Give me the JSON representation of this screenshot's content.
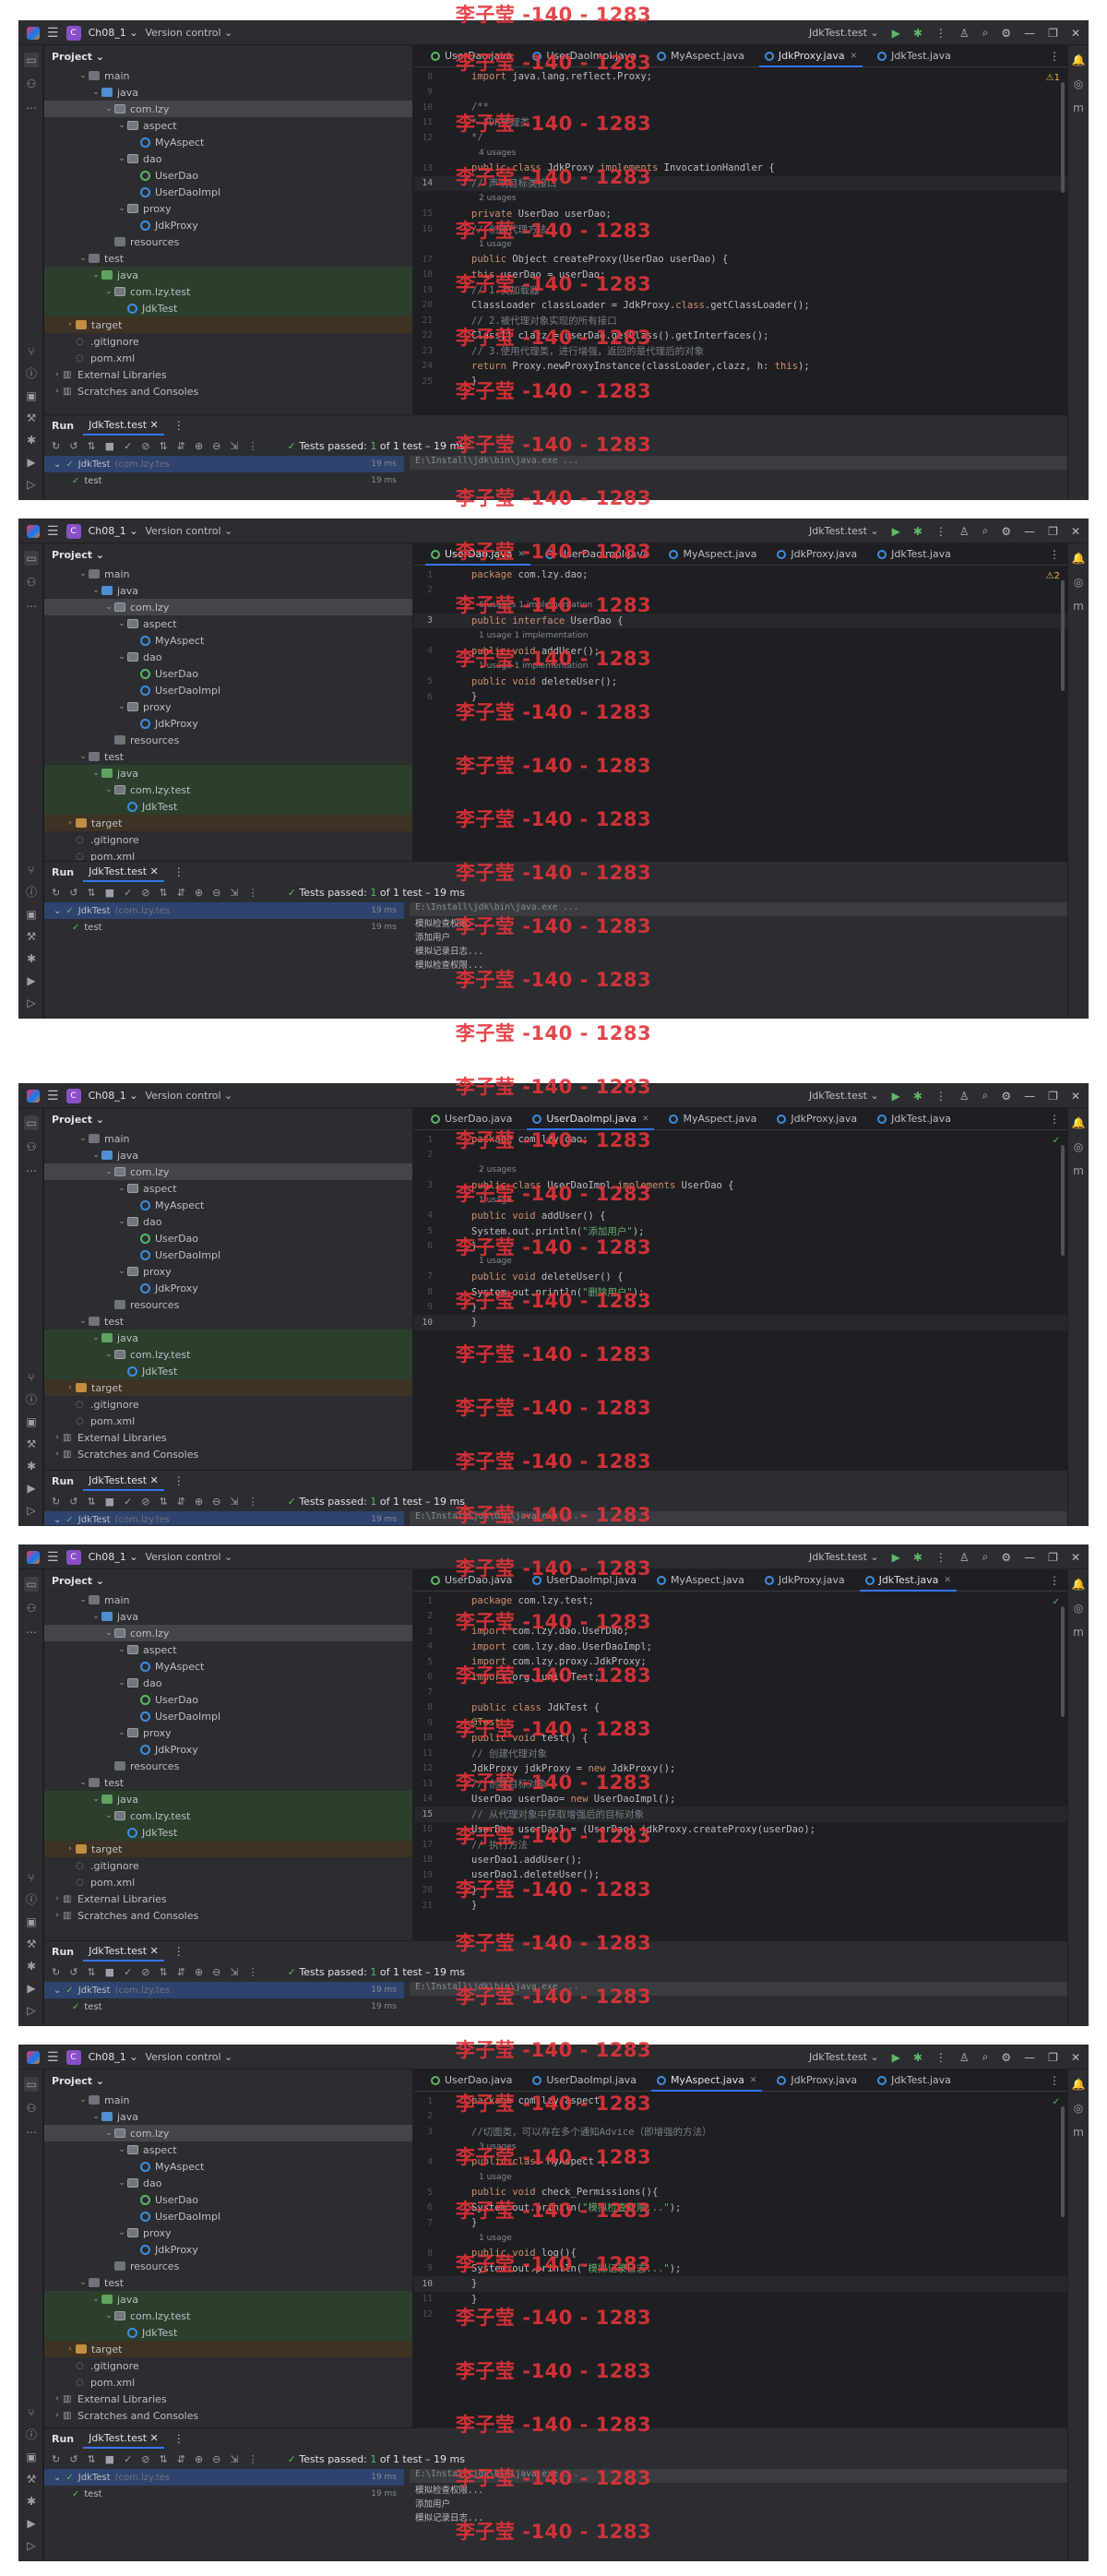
{
  "watermark": "李子莹 -140 - 1283",
  "ide": {
    "project_badge": "C",
    "project_name": "Ch08_1",
    "vcs": "Version control",
    "run_config": "JdkTest.test",
    "panel_title": "Project",
    "tree": [
      "main",
      "java",
      "com.lzy",
      "aspect",
      "MyAspect",
      "dao",
      "UserDao",
      "UserDaoImpl",
      "proxy",
      "JdkProxy",
      "resources",
      "test",
      "java",
      "com.lzy.test",
      "JdkTest",
      "target",
      ".gitignore",
      "pom.xml",
      "External Libraries",
      "Scratches and Consoles"
    ],
    "run_title": "Run",
    "run_tab": "JdkTest.test",
    "tests_passed_prefix": "Tests passed:",
    "tests_passed_count": "1",
    "tests_passed_suffix": "of 1 test – 19 ms",
    "run_tree": {
      "root": "JdkTest",
      "root_pkg": "(com.lzy.tes",
      "root_time": "19 ms",
      "child": "test",
      "child_time": "19 ms"
    },
    "console_path": "E:\\Install\\jdk\\bin\\java.exe ..."
  },
  "tabs": [
    "UserDao.java",
    "UserDaoImpl.java",
    "MyAspect.java",
    "JdkProxy.java",
    "JdkTest.java"
  ],
  "shots": [
    {
      "active_tab": 3,
      "indicator": "⚠1",
      "lines": [
        {
          "n": "8",
          "t": "import java.lang.reflect.Proxy;"
        },
        {
          "n": "9",
          "t": ""
        },
        {
          "n": "10",
          "t": "/**"
        },
        {
          "n": "11",
          "t": " * JDK代理类"
        },
        {
          "n": "12",
          "t": " */"
        },
        {
          "n": "",
          "t": "4 usages"
        },
        {
          "n": "13",
          "t": "public class JdkProxy implements InvocationHandler {"
        },
        {
          "n": "14",
          "t": "    // 声明目标类接口"
        },
        {
          "n": "",
          "t": "2 usages"
        },
        {
          "n": "15",
          "t": "    private UserDao userDao;"
        },
        {
          "n": "16",
          "t": "    // 创建代理方法"
        },
        {
          "n": "",
          "t": "1 usage"
        },
        {
          "n": "17",
          "t": "    public Object createProxy(UserDao userDao) {"
        },
        {
          "n": "18",
          "t": "        this.userDao = userDao;"
        },
        {
          "n": "19",
          "t": "        // 1.类加载器"
        },
        {
          "n": "20",
          "t": "        ClassLoader classLoader = JdkProxy.class.getClassLoader();"
        },
        {
          "n": "21",
          "t": "        // 2.被代理对象实现的所有接口"
        },
        {
          "n": "22",
          "t": "        Class[] clazz = userDao.getClass().getInterfaces();"
        },
        {
          "n": "23",
          "t": "        // 3.使用代理类，进行增强，返回的是代理后的对象"
        },
        {
          "n": "24",
          "t": "        return Proxy.newProxyInstance(classLoader,clazz, h: this);"
        },
        {
          "n": "25",
          "t": "    }"
        }
      ],
      "console": []
    },
    {
      "active_tab": 0,
      "indicator": "⚠2",
      "lines": [
        {
          "n": "1",
          "t": "package com.lzy.dao;"
        },
        {
          "n": "2",
          "t": ""
        },
        {
          "n": "",
          "t": "6 usages   1 implementation"
        },
        {
          "n": "3",
          "t": "public interface UserDao {"
        },
        {
          "n": "",
          "t": "1 usage   1 implementation"
        },
        {
          "n": "4",
          "t": "    public void addUser();"
        },
        {
          "n": "",
          "t": "1 usage   1 implementation"
        },
        {
          "n": "5",
          "t": "    public void deleteUser();"
        },
        {
          "n": "6",
          "t": "}"
        }
      ],
      "console": [
        "模拟检查权限...",
        "添加用户",
        "模拟记录日志...",
        "模拟检查权限..."
      ]
    },
    {
      "active_tab": 1,
      "indicator": "✓",
      "lines": [
        {
          "n": "1",
          "t": "package com.lzy.dao;"
        },
        {
          "n": "2",
          "t": ""
        },
        {
          "n": "",
          "t": "2 usages"
        },
        {
          "n": "3",
          "t": "public class UserDaoImpl implements UserDao {"
        },
        {
          "n": "",
          "t": "1 usage"
        },
        {
          "n": "4",
          "t": "    public void addUser() {"
        },
        {
          "n": "5",
          "t": "        System.out.println(\"添加用户\");"
        },
        {
          "n": "6",
          "t": "    }"
        },
        {
          "n": "",
          "t": "1 usage"
        },
        {
          "n": "7",
          "t": "    public void deleteUser() {"
        },
        {
          "n": "8",
          "t": "        System.out.println(\"删除用户\");"
        },
        {
          "n": "9",
          "t": "    }"
        },
        {
          "n": "10",
          "t": "}"
        }
      ],
      "console": []
    },
    {
      "active_tab": 4,
      "indicator": "✓",
      "lines": [
        {
          "n": "1",
          "t": "package com.lzy.test;"
        },
        {
          "n": "2",
          "t": ""
        },
        {
          "n": "3",
          "t": "import com.lzy.dao.UserDao;"
        },
        {
          "n": "4",
          "t": "import com.lzy.dao.UserDaoImpl;"
        },
        {
          "n": "5",
          "t": "import com.lzy.proxy.JdkProxy;"
        },
        {
          "n": "6",
          "t": "import org.junit.Test;"
        },
        {
          "n": "7",
          "t": ""
        },
        {
          "n": "8",
          "t": "public class JdkTest {"
        },
        {
          "n": "9",
          "t": "    @Test"
        },
        {
          "n": "10",
          "t": "    public void test() {"
        },
        {
          "n": "11",
          "t": "        // 创建代理对象"
        },
        {
          "n": "12",
          "t": "        JdkProxy jdkProxy = new JdkProxy();"
        },
        {
          "n": "13",
          "t": "        // 创建目标对象"
        },
        {
          "n": "14",
          "t": "        UserDao userDao= new UserDaoImpl();"
        },
        {
          "n": "15",
          "t": "        // 从代理对象中获取增强后的目标对象"
        },
        {
          "n": "16",
          "t": "        UserDao userDao1 = (UserDao) jdkProxy.createProxy(userDao);"
        },
        {
          "n": "17",
          "t": "        // 执行方法"
        },
        {
          "n": "18",
          "t": "        userDao1.addUser();"
        },
        {
          "n": "19",
          "t": "        userDao1.deleteUser();"
        },
        {
          "n": "20",
          "t": "    }"
        },
        {
          "n": "21",
          "t": "}"
        }
      ],
      "console": []
    },
    {
      "active_tab": 2,
      "indicator": "✓",
      "lines": [
        {
          "n": "1",
          "t": "package com.lzy.aspect;"
        },
        {
          "n": "2",
          "t": ""
        },
        {
          "n": "3",
          "t": "//切面类，可以存在多个通知Advice（即增强的方法）"
        },
        {
          "n": "",
          "t": "3 usages"
        },
        {
          "n": "4",
          "t": "public class MyAspect {"
        },
        {
          "n": "",
          "t": "1 usage"
        },
        {
          "n": "5",
          "t": "    public void check_Permissions(){"
        },
        {
          "n": "6",
          "t": "        System.out.println(\"模拟检查权限...\");"
        },
        {
          "n": "7",
          "t": "    }"
        },
        {
          "n": "",
          "t": "1 usage"
        },
        {
          "n": "8",
          "t": "    public void log(){"
        },
        {
          "n": "9",
          "t": "        System.out.println(\"模拟记录日志...\");"
        },
        {
          "n": "10",
          "t": "    }"
        },
        {
          "n": "11",
          "t": "}"
        },
        {
          "n": "12",
          "t": ""
        }
      ],
      "console": [
        "模拟检查权限...",
        "添加用户",
        "模拟记录日志..."
      ]
    }
  ]
}
